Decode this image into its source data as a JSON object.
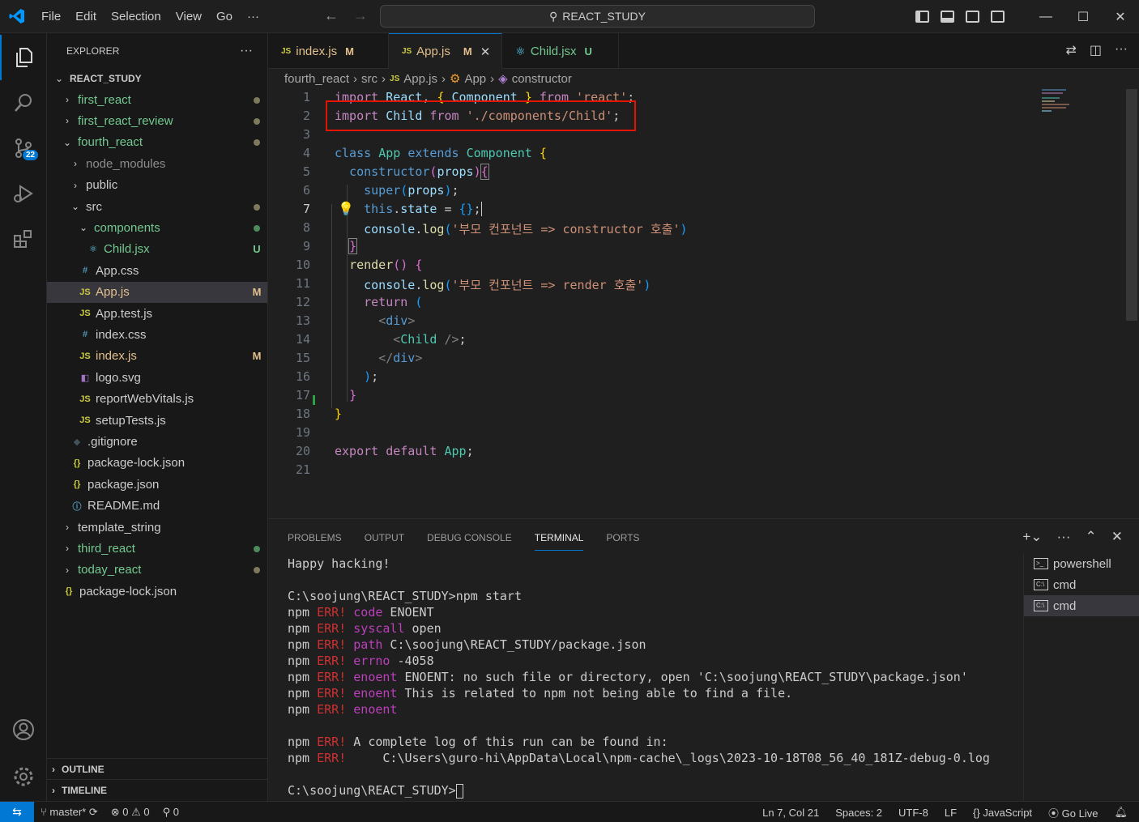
{
  "window": {
    "search_text": "REACT_STUDY",
    "menu": [
      "File",
      "Edit",
      "Selection",
      "View",
      "Go",
      "···"
    ]
  },
  "activity": {
    "source_control_badge": "22"
  },
  "explorer": {
    "title": "EXPLORER",
    "more": "···",
    "root": "REACT_STUDY",
    "items": [
      {
        "label": "first_react",
        "type": "folder",
        "indent": 0,
        "collapsed": true,
        "color": "#73c991",
        "status": "dot"
      },
      {
        "label": "first_react_review",
        "type": "folder",
        "indent": 0,
        "collapsed": true,
        "color": "#73c991",
        "status": "dot"
      },
      {
        "label": "fourth_react",
        "type": "folder",
        "indent": 0,
        "collapsed": false,
        "color": "#73c991",
        "status": "dot"
      },
      {
        "label": "node_modules",
        "type": "folder",
        "indent": 1,
        "collapsed": true,
        "color": "#8c8c8c",
        "status": ""
      },
      {
        "label": "public",
        "type": "folder",
        "indent": 1,
        "collapsed": true,
        "color": "#cccccc",
        "status": ""
      },
      {
        "label": "src",
        "type": "folder",
        "indent": 1,
        "collapsed": false,
        "color": "#cccccc",
        "status": "dot"
      },
      {
        "label": "components",
        "type": "folder",
        "indent": 2,
        "collapsed": false,
        "color": "#73c991",
        "status": "dot-green"
      },
      {
        "label": "Child.jsx",
        "type": "jsx",
        "indent": 3,
        "color": "#73c991",
        "status": "U"
      },
      {
        "label": "App.css",
        "type": "css",
        "indent": 2,
        "color": "#cccccc",
        "status": ""
      },
      {
        "label": "App.js",
        "type": "js",
        "indent": 2,
        "color": "#e2c08d",
        "status": "M",
        "selected": true
      },
      {
        "label": "App.test.js",
        "type": "js",
        "indent": 2,
        "color": "#cccccc",
        "status": ""
      },
      {
        "label": "index.css",
        "type": "css",
        "indent": 2,
        "color": "#cccccc",
        "status": ""
      },
      {
        "label": "index.js",
        "type": "js",
        "indent": 2,
        "color": "#e2c08d",
        "status": "M"
      },
      {
        "label": "logo.svg",
        "type": "svg",
        "indent": 2,
        "color": "#cccccc",
        "status": ""
      },
      {
        "label": "reportWebVitals.js",
        "type": "js",
        "indent": 2,
        "color": "#cccccc",
        "status": ""
      },
      {
        "label": "setupTests.js",
        "type": "js",
        "indent": 2,
        "color": "#cccccc",
        "status": ""
      },
      {
        "label": ".gitignore",
        "type": "git",
        "indent": 1,
        "color": "#cccccc",
        "status": ""
      },
      {
        "label": "package-lock.json",
        "type": "json",
        "indent": 1,
        "color": "#cccccc",
        "status": ""
      },
      {
        "label": "package.json",
        "type": "json",
        "indent": 1,
        "color": "#cccccc",
        "status": ""
      },
      {
        "label": "README.md",
        "type": "info",
        "indent": 1,
        "color": "#cccccc",
        "status": ""
      },
      {
        "label": "template_string",
        "type": "folder",
        "indent": 0,
        "collapsed": true,
        "color": "#cccccc",
        "status": ""
      },
      {
        "label": "third_react",
        "type": "folder",
        "indent": 0,
        "collapsed": true,
        "color": "#73c991",
        "status": "dot-green"
      },
      {
        "label": "today_react",
        "type": "folder",
        "indent": 0,
        "collapsed": true,
        "color": "#73c991",
        "status": "dot"
      },
      {
        "label": "package-lock.json",
        "type": "json",
        "indent": 0,
        "color": "#cccccc",
        "status": ""
      }
    ],
    "outline": "OUTLINE",
    "timeline": "TIMELINE"
  },
  "tabs": [
    {
      "label": "index.js",
      "status": "M",
      "icon": "JS",
      "color": "#e2c08d",
      "active": false
    },
    {
      "label": "App.js",
      "status": "M",
      "icon": "JS",
      "color": "#e2c08d",
      "active": true
    },
    {
      "label": "Child.jsx",
      "status": "U",
      "icon": "react",
      "color": "#73c991",
      "active": false
    }
  ],
  "breadcrumb": [
    "fourth_react",
    "src",
    "App.js",
    "App",
    "constructor"
  ],
  "editor": {
    "line_numbers": [
      "1",
      "2",
      "3",
      "4",
      "5",
      "6",
      "7",
      "8",
      "9",
      "10",
      "11",
      "12",
      "13",
      "14",
      "15",
      "16",
      "17",
      "18",
      "19",
      "20",
      "21"
    ],
    "current_line": "7"
  },
  "panel": {
    "tabs": [
      "PROBLEMS",
      "OUTPUT",
      "DEBUG CONSOLE",
      "TERMINAL",
      "PORTS"
    ],
    "active_tab": "TERMINAL",
    "terminals": [
      "powershell",
      "cmd",
      "cmd"
    ],
    "lines": [
      {
        "prefix": "Happy hacking!",
        "key": "",
        "rest": ""
      },
      {
        "prefix": "",
        "key": "",
        "rest": ""
      },
      {
        "prefix": "C:\\soojung\\REACT_STUDY>npm start",
        "key": "",
        "rest": ""
      },
      {
        "prefix": "npm ",
        "err": "ERR!",
        "key": " code",
        "rest": " ENOENT"
      },
      {
        "prefix": "npm ",
        "err": "ERR!",
        "key": " syscall",
        "rest": " open"
      },
      {
        "prefix": "npm ",
        "err": "ERR!",
        "key": " path",
        "rest": " C:\\soojung\\REACT_STUDY/package.json"
      },
      {
        "prefix": "npm ",
        "err": "ERR!",
        "key": " errno",
        "rest": " -4058"
      },
      {
        "prefix": "npm ",
        "err": "ERR!",
        "key": " enoent",
        "rest": " ENOENT: no such file or directory, open 'C:\\soojung\\REACT_STUDY\\package.json'"
      },
      {
        "prefix": "npm ",
        "err": "ERR!",
        "key": " enoent",
        "rest": " This is related to npm not being able to find a file."
      },
      {
        "prefix": "npm ",
        "err": "ERR!",
        "key": " enoent",
        "rest": ""
      },
      {
        "prefix": "",
        "key": "",
        "rest": ""
      },
      {
        "prefix": "npm ",
        "err": "ERR!",
        "key": "",
        "rest": " A complete log of this run can be found in:"
      },
      {
        "prefix": "npm ",
        "err": "ERR!",
        "key": "",
        "rest": "     C:\\Users\\guro-hi\\AppData\\Local\\npm-cache\\_logs\\2023-10-18T08_56_40_181Z-debug-0.log"
      },
      {
        "prefix": "",
        "key": "",
        "rest": ""
      },
      {
        "prefix": "C:\\soojung\\REACT_STUDY>",
        "key": "",
        "rest": ""
      }
    ]
  },
  "status": {
    "branch": "master*",
    "errors": "0",
    "warnings": "0",
    "ports": "0",
    "position": "Ln 7, Col 21",
    "spaces": "Spaces: 2",
    "encoding": "UTF-8",
    "eol": "LF",
    "language": "JavaScript",
    "golive": "Go Live"
  }
}
